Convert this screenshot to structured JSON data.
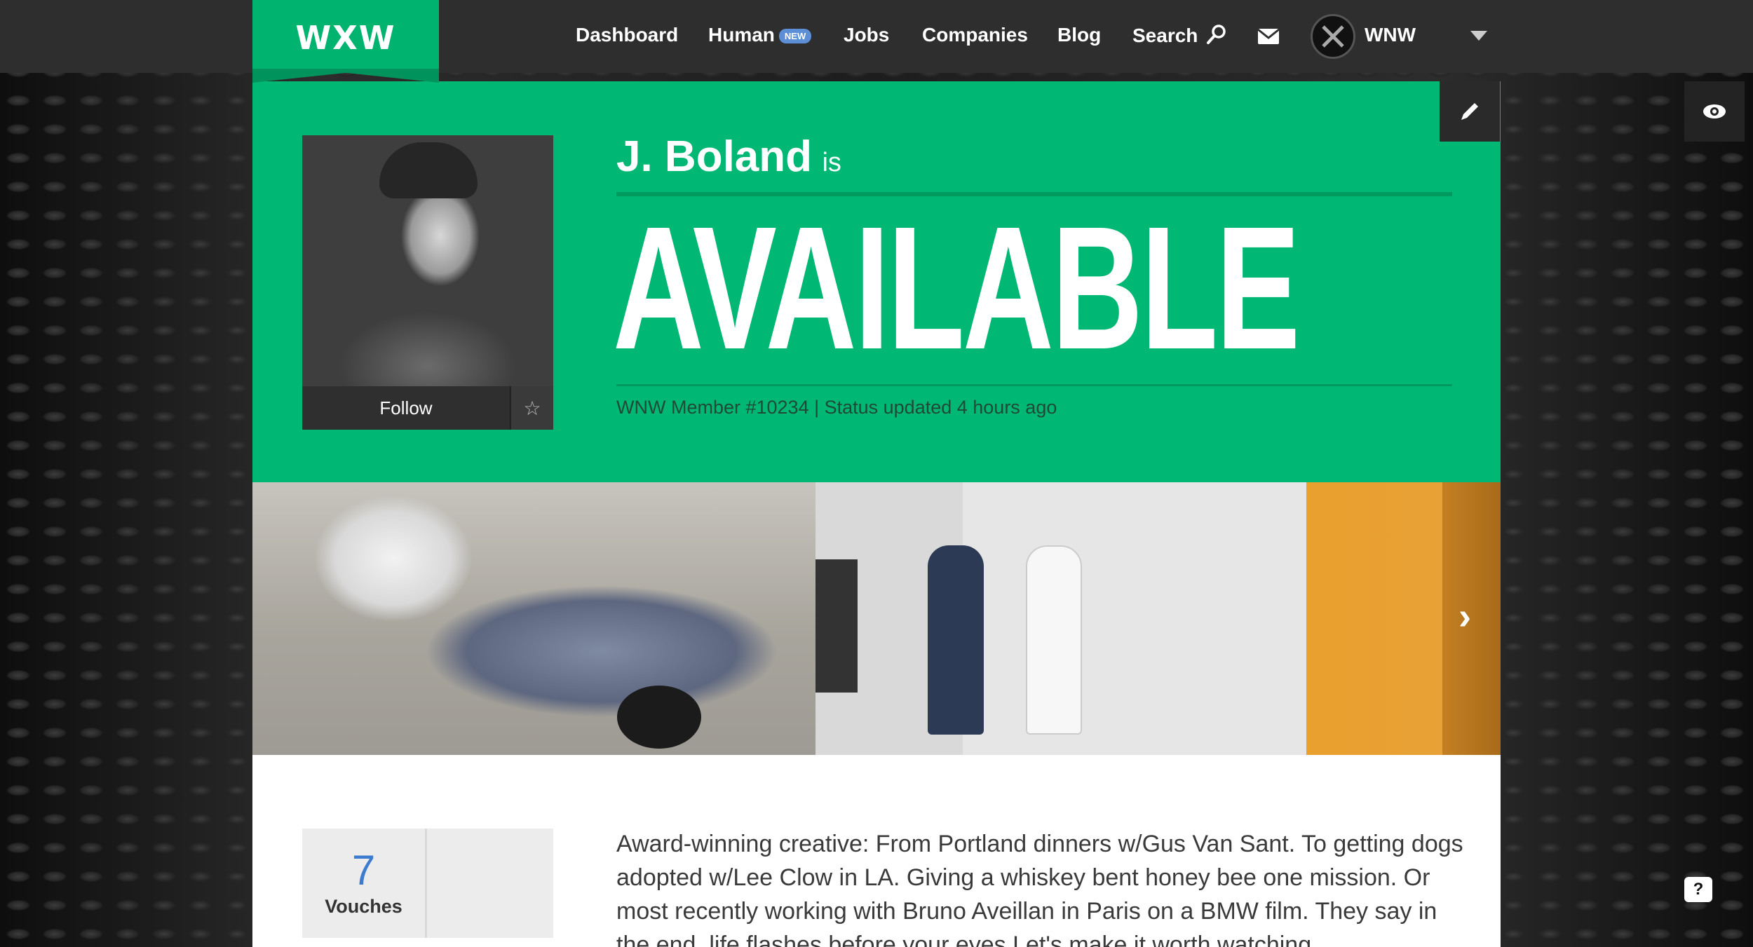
{
  "header": {
    "logo": "WXW",
    "nav": {
      "dashboard": "Dashboard",
      "human": "Human",
      "human_badge": "NEW",
      "jobs": "Jobs",
      "companies": "Companies",
      "blog": "Blog",
      "search": "Search"
    },
    "user_name": "WNW",
    "icons": {
      "search": "search-icon",
      "mail": "mail-icon",
      "dropdown": "caret-down-icon"
    }
  },
  "profile": {
    "name": "J. Boland",
    "is_word": "is",
    "status": "AVAILABLE",
    "meta": "WNW Member #10234 | Status updated 4 hours ago",
    "follow_label": "Follow"
  },
  "vouches": {
    "count": "7",
    "label": "Vouches"
  },
  "bio": "Award-winning creative: From Portland dinners w/Gus Van Sant. To getting dogs adopted w/Lee Clow in LA. Giving a whiskey bent honey bee one mission. Or most recently working with Bruno Aveillan in Paris on a BMW film. They say in the end, life flashes before your eyes Let's make it worth watching.",
  "colors": {
    "brand_green": "#00b874",
    "topbar": "#2e2e2e",
    "vouch_blue": "#3b7bd0"
  }
}
